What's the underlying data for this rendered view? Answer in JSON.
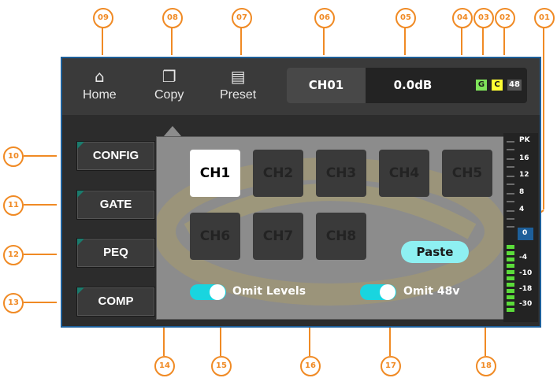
{
  "callouts": [
    "01",
    "02",
    "03",
    "04",
    "05",
    "06",
    "07",
    "08",
    "09",
    "10",
    "11",
    "12",
    "13",
    "14",
    "15",
    "16",
    "17",
    "18"
  ],
  "nav": {
    "home": {
      "label": "Home",
      "icon": "home-icon"
    },
    "copy": {
      "label": "Copy",
      "icon": "copy-icon"
    },
    "preset": {
      "label": "Preset",
      "icon": "preset-icon"
    }
  },
  "status": {
    "channel": "CH01",
    "gain": "0.0dB",
    "badges": [
      {
        "text": "G",
        "color": "#7fe35a"
      },
      {
        "text": "C",
        "color": "#ffff33"
      },
      {
        "text": "48",
        "color": "#555555"
      }
    ]
  },
  "sidebar": {
    "items": [
      {
        "label": "CONFIG"
      },
      {
        "label": "GATE"
      },
      {
        "label": "PEQ"
      },
      {
        "label": "COMP"
      }
    ]
  },
  "copy_popup": {
    "channels": [
      "CH1",
      "CH2",
      "CH3",
      "CH4",
      "CH5",
      "CH6",
      "CH7",
      "CH8"
    ],
    "selected": "CH1",
    "paste_label": "Paste",
    "omit_levels": {
      "label": "Omit Levels",
      "on": true
    },
    "omit_48v": {
      "label": "Omit 48v",
      "on": true
    }
  },
  "meter": {
    "labels": [
      "PK",
      "16",
      "12",
      "8",
      "4",
      "0",
      "-4",
      "-10",
      "-18",
      "-30"
    ]
  },
  "colors": {
    "accent": "#f08a24",
    "frame": "#1d5f9a",
    "toggle": "#19d5df",
    "paste": "#8ef0f2",
    "meter_green": "#5bdc3a"
  }
}
